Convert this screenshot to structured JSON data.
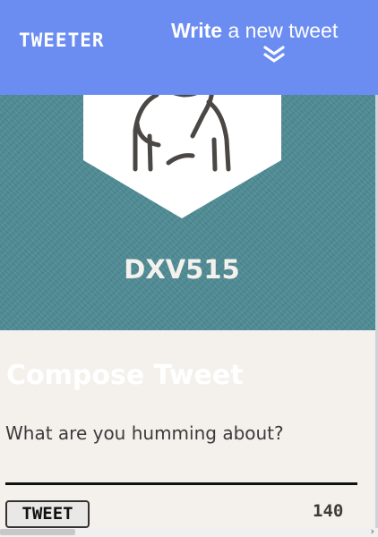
{
  "nav": {
    "brand": "TWEETER",
    "write_bold": "Write",
    "write_rest": " a new tweet",
    "toggle_icon": "double-chevron-down-icon"
  },
  "profile": {
    "avatar_icon": "user-silhouette-icon",
    "handle": "DXV515"
  },
  "compose": {
    "title": "Compose Tweet",
    "placeholder": "What are you humming about?",
    "submit_label": "TWEET",
    "char_count": "140"
  },
  "colors": {
    "nav_bg": "#6b8df2",
    "hero_bg": "#4f8b95",
    "page_bg": "#f4f1ec"
  }
}
